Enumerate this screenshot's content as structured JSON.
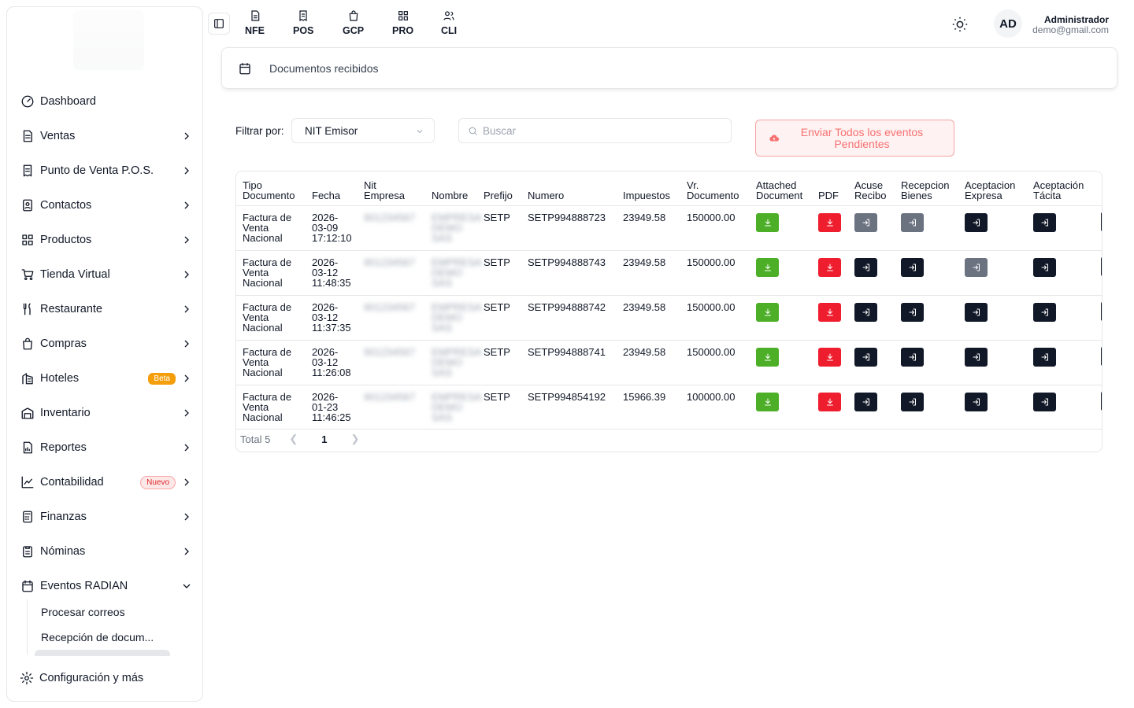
{
  "topbar": {
    "apps": [
      {
        "label": "NFE",
        "icon": "file-icon"
      },
      {
        "label": "POS",
        "icon": "receipt-icon"
      },
      {
        "label": "GCP",
        "icon": "bag-icon"
      },
      {
        "label": "PRO",
        "icon": "grid-icon"
      },
      {
        "label": "CLI",
        "icon": "users-icon"
      }
    ],
    "user_initials": "AD",
    "user_name": "Administrador",
    "user_email": "demo@gmail.com"
  },
  "sidebar": {
    "items": [
      {
        "label": "Dashboard"
      },
      {
        "label": "Ventas"
      },
      {
        "label": "Punto de Venta P.O.S."
      },
      {
        "label": "Contactos"
      },
      {
        "label": "Productos"
      },
      {
        "label": "Tienda Virtual"
      },
      {
        "label": "Restaurante"
      },
      {
        "label": "Compras"
      },
      {
        "label": "Hoteles",
        "badge": "Beta"
      },
      {
        "label": "Inventario"
      },
      {
        "label": "Reportes"
      },
      {
        "label": "Contabilidad",
        "badge": "Nuevo"
      },
      {
        "label": "Finanzas"
      },
      {
        "label": "Nóminas"
      },
      {
        "label": "Eventos RADIAN"
      }
    ],
    "sub_items": [
      "Procesar correos",
      "Recepción de docum..."
    ],
    "footer": "Configuración y más"
  },
  "breadcrumb": "Documentos recibidos",
  "filter": {
    "label": "Filtrar por:",
    "selected": "NIT Emisor",
    "search_placeholder": "Buscar",
    "send_button": "Enviar Todos los eventos Pendientes"
  },
  "table": {
    "headers": [
      "Tipo Documento",
      "Fecha",
      "Nit Empresa",
      "Nombre",
      "Prefijo",
      "Numero",
      "Impuestos",
      "Vr. Documento",
      "Attached Document",
      "PDF",
      "Acuse Recibo",
      "Recepcion Bienes",
      "Aceptacion Expresa",
      "Aceptación Tácita"
    ],
    "rows": [
      {
        "tipo": "Factura de Venta Nacional",
        "fecha": "2026-03-09 17:12:10",
        "nit": "901234567",
        "nombre": "EMPRESA DEMO SAS",
        "prefijo": "SETP",
        "numero": "SETP994888723",
        "impuestos": "23949.58",
        "valor": "150000.00",
        "acuse": "gray",
        "recepcion": "gray",
        "expresa": "dark",
        "tacita": "dark"
      },
      {
        "tipo": "Factura de Venta Nacional",
        "fecha": "2026-03-12 11:48:35",
        "nit": "901234567",
        "nombre": "EMPRESA DEMO SAS",
        "prefijo": "SETP",
        "numero": "SETP994888743",
        "impuestos": "23949.58",
        "valor": "150000.00",
        "acuse": "dark",
        "recepcion": "dark",
        "expresa": "gray",
        "tacita": "dark"
      },
      {
        "tipo": "Factura de Venta Nacional",
        "fecha": "2026-03-12 11:37:35",
        "nit": "901234567",
        "nombre": "EMPRESA DEMO SAS",
        "prefijo": "SETP",
        "numero": "SETP994888742",
        "impuestos": "23949.58",
        "valor": "150000.00",
        "acuse": "dark",
        "recepcion": "dark",
        "expresa": "dark",
        "tacita": "dark"
      },
      {
        "tipo": "Factura de Venta Nacional",
        "fecha": "2026-03-12 11:26:08",
        "nit": "901234567",
        "nombre": "EMPRESA DEMO SAS",
        "prefijo": "SETP",
        "numero": "SETP994888741",
        "impuestos": "23949.58",
        "valor": "150000.00",
        "acuse": "dark",
        "recepcion": "dark",
        "expresa": "dark",
        "tacita": "dark"
      },
      {
        "tipo": "Factura de Venta Nacional",
        "fecha": "2026-01-23 11:46:25",
        "nit": "901234567",
        "nombre": "EMPRESA DEMO SAS",
        "prefijo": "SETP",
        "numero": "SETP994854192",
        "impuestos": "15966.39",
        "valor": "100000.00",
        "acuse": "dark",
        "recepcion": "dark",
        "expresa": "dark",
        "tacita": "dark"
      }
    ]
  },
  "pagination": {
    "total": "Total 5",
    "page": "1"
  },
  "colors": {
    "green": "#4caf27",
    "red": "#ef1e2f",
    "dark": "#111827",
    "gray": "#6b7280",
    "accent_red_light": "#fef2f2"
  }
}
